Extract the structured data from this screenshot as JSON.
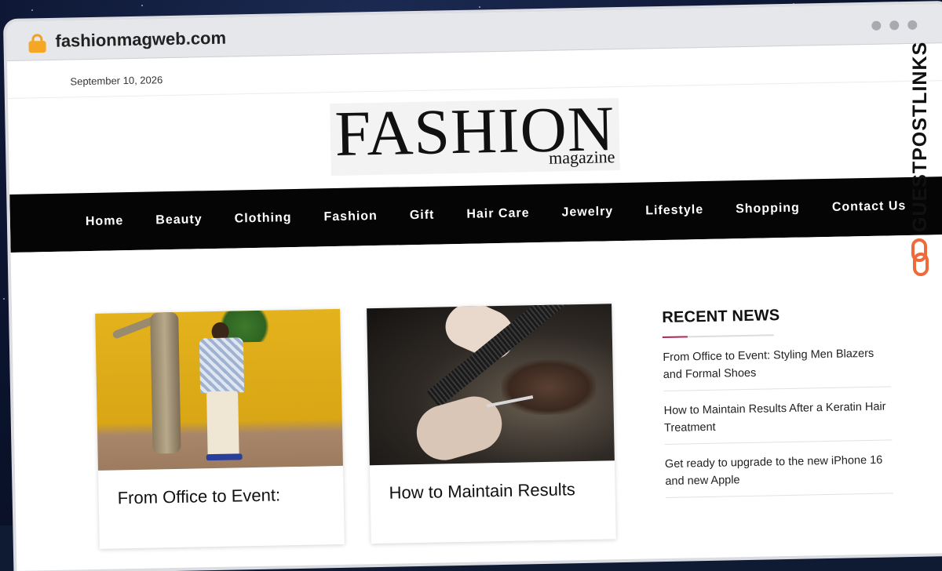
{
  "browser": {
    "url": "fashionmagweb.com"
  },
  "topbar": {
    "date": "September 10, 2026"
  },
  "logo": {
    "main": "FASHION",
    "sub": "magazine"
  },
  "nav": {
    "items": [
      {
        "label": "Home"
      },
      {
        "label": "Beauty"
      },
      {
        "label": "Clothing"
      },
      {
        "label": "Fashion"
      },
      {
        "label": "Gift"
      },
      {
        "label": "Hair Care"
      },
      {
        "label": "Jewelry"
      },
      {
        "label": "Lifestyle"
      },
      {
        "label": "Shopping"
      },
      {
        "label": "Contact Us"
      }
    ]
  },
  "posts": [
    {
      "title": "From Office to Event:"
    },
    {
      "title": "How to Maintain Results"
    }
  ],
  "sidebar": {
    "heading": "RECENT NEWS",
    "items": [
      {
        "title": "From Office to Event: Styling Men Blazers and Formal Shoes"
      },
      {
        "title": "How to Maintain Results After a Keratin Hair Treatment"
      },
      {
        "title": "Get ready to upgrade to the new iPhone 16 and new Apple"
      }
    ]
  },
  "watermark": {
    "text": "GUESTPOSTLINKS"
  },
  "colors": {
    "nav_bg": "#050505",
    "accent": "#b5275a",
    "lock": "#f5a623",
    "chain": "#ef6a3a"
  },
  "icons": {
    "lock": "lock-icon",
    "window_dots": "window-dots-icon",
    "chain": "chain-link-icon"
  }
}
